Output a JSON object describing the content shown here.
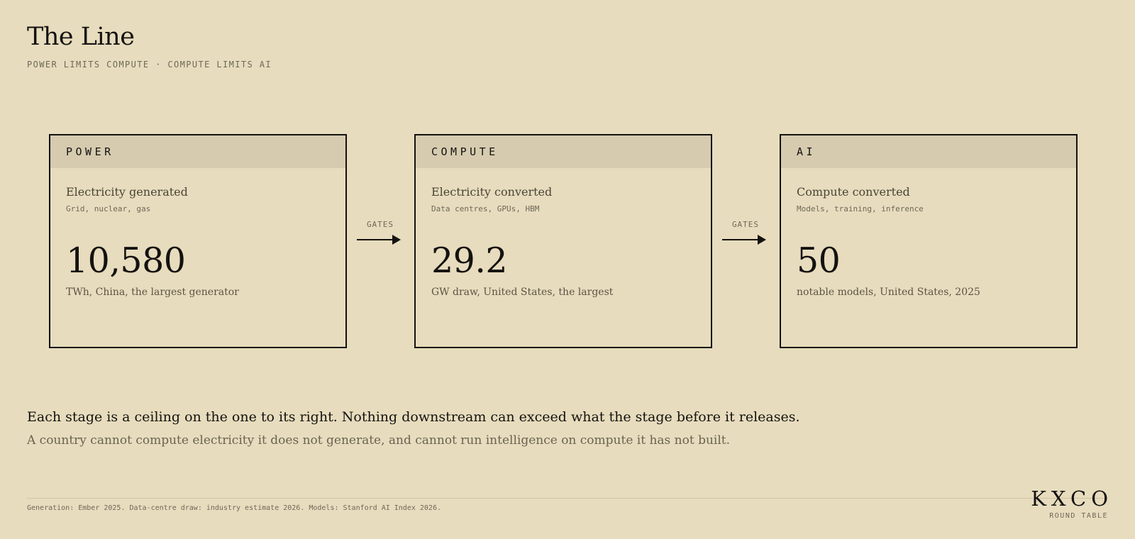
{
  "header": {
    "title": "The Line",
    "subtitle": "POWER LIMITS COMPUTE · COMPUTE LIMITS AI"
  },
  "stages": [
    {
      "label": "POWER",
      "heading": "Electricity generated",
      "subheading": "Grid, nuclear, gas",
      "value": "10,580",
      "caption": "TWh, China, the largest generator"
    },
    {
      "label": "COMPUTE",
      "heading": "Electricity converted",
      "subheading": "Data centres, GPUs, HBM",
      "value": "29.2",
      "caption": "GW draw, United States, the largest"
    },
    {
      "label": "AI",
      "heading": "Compute converted",
      "subheading": "Models, training, inference",
      "value": "50",
      "caption": "notable models, United States, 2025"
    }
  ],
  "connectors": [
    {
      "label": "GATES"
    },
    {
      "label": "GATES"
    }
  ],
  "takeaway": {
    "main": "Each stage is a ceiling on the one to its right. Nothing downstream can exceed what the stage before it releases.",
    "sub": "A country cannot compute electricity it does not generate, and cannot run intelligence on compute it has not built."
  },
  "footer": {
    "source": "Generation: Ember 2025. Data-centre draw: industry estimate 2026. Models: Stanford AI Index 2026."
  },
  "brand": {
    "logo": "KXCO",
    "tagline": "ROUND TABLE"
  },
  "colors": {
    "background": "#e7dcbd",
    "card_header": "#d6cbaf",
    "ink": "#141210",
    "muted": "#6f685a"
  }
}
